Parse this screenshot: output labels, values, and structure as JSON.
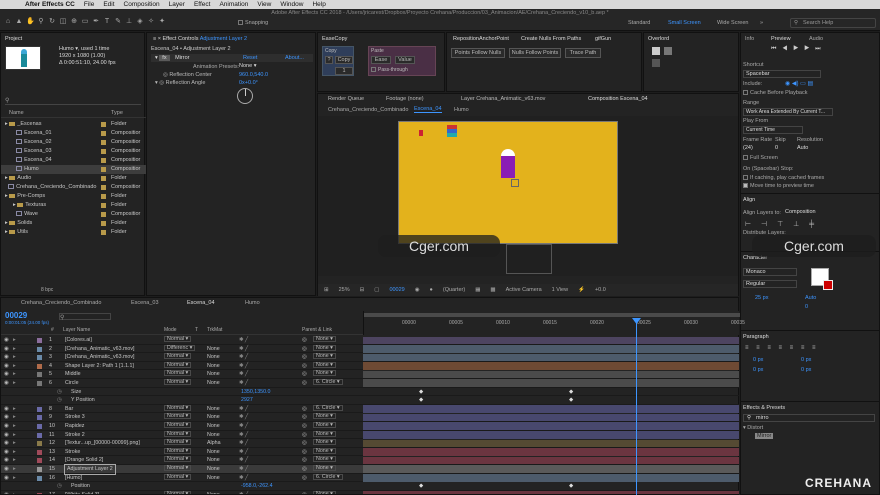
{
  "menubar": {
    "app": "After Effects CC",
    "items": [
      "File",
      "Edit",
      "Composition",
      "Layer",
      "Effect",
      "Animation",
      "View",
      "Window",
      "Help"
    ]
  },
  "title": "Adobe After Effects CC 2018 - /Users/jricarest/Dropbox/Proyecto Crehana/Produccion/03_Animacion/AE/Crehana_Creciendo_v10_b.aep *",
  "toolbar": {
    "snapping": "Snapping",
    "workspaces": [
      "Standard",
      "Small Screen",
      "Wide Screen"
    ],
    "active_workspace": "Small Screen",
    "search": "Search Help"
  },
  "project": {
    "tab": "Project",
    "thumb_name": "Humo ▾, used 1 time",
    "thumb_info1": "1920 x 1080 (1.00)",
    "thumb_info2": "Δ 0:00:51:10, 24.00 fps",
    "col_name": "Name",
    "col_type": "Type",
    "items": [
      {
        "name": "_Escenas",
        "type": "Folder",
        "kind": "folder",
        "indent": 0,
        "color": "#b89a4a"
      },
      {
        "name": "Escena_01",
        "type": "Compositior",
        "kind": "comp",
        "indent": 1,
        "color": "#b89a4a"
      },
      {
        "name": "Escena_02",
        "type": "Compositior",
        "kind": "comp",
        "indent": 1,
        "color": "#b89a4a"
      },
      {
        "name": "Escena_03",
        "type": "Compositior",
        "kind": "comp",
        "indent": 1,
        "color": "#b89a4a"
      },
      {
        "name": "Escena_04",
        "type": "Compositior",
        "kind": "comp",
        "indent": 1,
        "color": "#b89a4a"
      },
      {
        "name": "Humo",
        "type": "Compositior",
        "kind": "comp",
        "indent": 1,
        "color": "#b89a4a",
        "selected": true
      },
      {
        "name": "Audio",
        "type": "Folder",
        "kind": "folder",
        "indent": 0,
        "color": "#b89a4a"
      },
      {
        "name": "Crehana_Creciendo_Combinado",
        "type": "Compositior",
        "kind": "comp",
        "indent": 0,
        "color": "#b89a4a"
      },
      {
        "name": "Pre-Comps",
        "type": "Folder",
        "kind": "folder",
        "indent": 0,
        "color": "#b89a4a"
      },
      {
        "name": "Texturas",
        "type": "Folder",
        "kind": "folder",
        "indent": 1,
        "color": "#b89a4a"
      },
      {
        "name": "Wave",
        "type": "Compositior",
        "kind": "comp",
        "indent": 1,
        "color": "#b89a4a"
      },
      {
        "name": "Solids",
        "type": "Folder",
        "kind": "folder",
        "indent": 0,
        "color": "#b89a4a"
      },
      {
        "name": "Utils",
        "type": "Folder",
        "kind": "folder",
        "indent": 0,
        "color": "#b89a4a"
      }
    ],
    "bpc": "8 bpc"
  },
  "effects": {
    "tab": "Effect Controls",
    "layer": "Adjustment Layer 2",
    "header": "Escena_04 • Adjustment Layer 2",
    "effect": "Mirror",
    "reset": "Reset",
    "about": "About...",
    "presets_label": "Animation Presets:",
    "presets_value": "None",
    "p1": "Reflection Center",
    "p1v": "960.0,540.0",
    "p2": "Reflection Angle",
    "p2v": "0x+0.0°"
  },
  "easecopy": {
    "tab": "EaseCopy",
    "copy_label": "Copy",
    "copy_btn": "Copy",
    "copy_val": "1",
    "paste_label": "Paste",
    "ease": "Ease",
    "value": "Value",
    "pass": "Pass-through"
  },
  "reposition": {
    "tab": "RepositionAnchorPoint",
    "tab2": "Create Nulls From Paths",
    "tab3": "gifGun",
    "b1": "Points Follow Nulls",
    "b2": "Nulls Follow Points",
    "b3": "Trace Path"
  },
  "overlord": {
    "tab": "Overlord"
  },
  "viewer": {
    "tabs": [
      "Render Queue",
      "Footage (none)",
      "Layer Crehana_Animatic_v63.mov",
      "Composition Escena_04"
    ],
    "sub": [
      "Crehana_Creciendo_Combinado",
      "Escena_04",
      "Humo"
    ],
    "zoom": "25%",
    "timecode": "00029",
    "quality": "(Quarter)",
    "camera": "Active Camera",
    "views": "1 View",
    "exposure": "+0.0",
    "bg": "#e3b21c"
  },
  "info": {
    "tabs": [
      "Info",
      "Preview",
      "Audio"
    ],
    "shortcut_label": "Shortcut",
    "shortcut": "Spacebar",
    "include": "Include:",
    "cache": "Cache Before Playback",
    "range_label": "Range",
    "range": "Work Area Extended By Current T...",
    "play_from_label": "Play From",
    "play_from": "Current Time",
    "fr_label": "Frame Rate",
    "skip_label": "Skip",
    "res_label": "Resolution",
    "fr": "(24)",
    "skip": "0",
    "res": "Auto",
    "fullscreen": "Full Screen",
    "stop_label": "On (Spacebar) Stop:",
    "stop1": "If caching, play cached frames",
    "stop2": "Move time to preview time",
    "align": "Align",
    "align_to": "Align Layers to:",
    "align_val": "Composition",
    "distribute": "Distribute Layers:",
    "character": "Character",
    "font": "Monaco",
    "style": "Regular",
    "size": "25 px",
    "leading": "Auto",
    "tracking": "0",
    "para": "Paragraph",
    "px": "0 px",
    "ep_tab": "Effects & Presets",
    "ep_search": "mirro",
    "ep_cat": "Distort",
    "ep_item": "Mirror"
  },
  "timeline": {
    "tabs": [
      "Crehana_Creciendo_Combinado",
      "Escena_03",
      "Escena_04",
      "Humo"
    ],
    "active": "Escena_04",
    "time": "00029",
    "timesub": "0:00:01:05 (24.00 fps)",
    "cols": [
      "#",
      "Layer Name",
      "Mode",
      "T",
      "TrkMat",
      "Parent & Link"
    ],
    "ruler": [
      "00000",
      "00005",
      "00010",
      "00015",
      "00020",
      "00025",
      "00030",
      "00035"
    ],
    "layers": [
      {
        "num": "1",
        "name": "[Colores.ai]",
        "mode": "Normal",
        "trk": "",
        "parent": "None",
        "color": "#8b6d9c",
        "bar": "#4d4460",
        "kind": "layer"
      },
      {
        "num": "2",
        "name": "[Crehana_Animatic_v63.mov]",
        "mode": "Differenc",
        "trk": "None",
        "parent": "None",
        "color": "#6a8aa8",
        "bar": "#4d5b6b",
        "kind": "layer"
      },
      {
        "num": "3",
        "name": "[Crehana_Animatic_v63.mov]",
        "mode": "Normal",
        "trk": "None",
        "parent": "None",
        "color": "#6a8aa8",
        "bar": "#4d5b6b",
        "kind": "layer"
      },
      {
        "num": "4",
        "name": "Shape Layer 2: Path 1 [1.1.1]",
        "mode": "Normal",
        "trk": "None",
        "parent": "None",
        "color": "#b06b4a",
        "bar": "#6e4a34",
        "kind": "layer"
      },
      {
        "num": "5",
        "name": "Middle",
        "mode": "Normal",
        "trk": "None",
        "parent": "None",
        "color": "#777",
        "bar": "#4b4b4b",
        "kind": "layer"
      },
      {
        "num": "6",
        "name": "Circle",
        "mode": "Normal",
        "trk": "None",
        "parent": "6. Circle",
        "color": "#777",
        "bar": "#4b4b4b",
        "kind": "layer"
      },
      {
        "num": "",
        "name": "Size",
        "mode": "",
        "trk": "",
        "parent": "",
        "value": "1350,1350.0",
        "color": "",
        "bar": "",
        "kind": "prop"
      },
      {
        "num": "7",
        "name": "Y Position",
        "mode": "",
        "trk": "",
        "parent": "",
        "value": "2927",
        "color": "",
        "bar": "",
        "kind": "prop"
      },
      {
        "num": "8",
        "name": "Bar",
        "mode": "Normal",
        "trk": "None",
        "parent": "6. Circle",
        "color": "#6a6aa8",
        "bar": "#48486e",
        "kind": "layer"
      },
      {
        "num": "9",
        "name": "Stroke 3",
        "mode": "Normal",
        "trk": "None",
        "parent": "None",
        "color": "#6a6aa8",
        "bar": "#48486e",
        "kind": "layer"
      },
      {
        "num": "10",
        "name": "Rapidez",
        "mode": "Normal",
        "trk": "None",
        "parent": "None",
        "color": "#6a6aa8",
        "bar": "#48486e",
        "kind": "layer"
      },
      {
        "num": "11",
        "name": "Stroke 2",
        "mode": "Normal",
        "trk": "None",
        "parent": "None",
        "color": "#6a6aa8",
        "bar": "#48486e",
        "kind": "layer"
      },
      {
        "num": "12",
        "name": "[Textur...up_[00000-00099].png]",
        "mode": "Normal",
        "trk": "Alpha",
        "parent": "None",
        "color": "#8a7a4a",
        "bar": "#554a33",
        "kind": "layer"
      },
      {
        "num": "13",
        "name": "Stroke",
        "mode": "Normal",
        "trk": "None",
        "parent": "None",
        "color": "#a04a5a",
        "bar": "#6b3540",
        "kind": "layer"
      },
      {
        "num": "14",
        "name": "[Orange Solid 2]",
        "mode": "Normal",
        "trk": "None",
        "parent": "None",
        "color": "#a04a5a",
        "bar": "#6b3540",
        "kind": "layer"
      },
      {
        "num": "15",
        "name": "Adjustment Layer 2",
        "mode": "Normal",
        "trk": "None",
        "parent": "None",
        "color": "#999",
        "bar": "#5a5a5a",
        "kind": "layer",
        "selected": true
      },
      {
        "num": "16",
        "name": "[Humo]",
        "mode": "Normal",
        "trk": "None",
        "parent": "6. Circle",
        "color": "#6a8aa8",
        "bar": "#4d5b6b",
        "kind": "layer"
      },
      {
        "num": "",
        "name": "Position",
        "mode": "",
        "trk": "",
        "parent": "",
        "value": "-958.0,-262.4",
        "color": "",
        "bar": "",
        "kind": "prop"
      },
      {
        "num": "17",
        "name": "[White Solid 3]",
        "mode": "Normal",
        "trk": "None",
        "parent": "None",
        "color": "#a04a5a",
        "bar": "#6b3540",
        "kind": "layer"
      }
    ]
  },
  "watermark": "Cger.com",
  "brand": "CREHANA"
}
